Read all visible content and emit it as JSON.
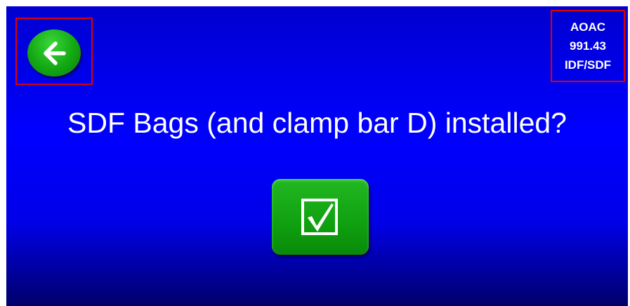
{
  "screen": {
    "question": "SDF Bags (and clamp bar D) installed?",
    "method": {
      "line1": "AOAC",
      "line2": "991.43",
      "line3": "IDF/SDF"
    },
    "back_icon": "arrow-left-icon",
    "confirm_icon": "checkbox-check-icon"
  },
  "colors": {
    "background": "#0000ff",
    "button_green": "#12a812",
    "highlight_frame": "#e00000",
    "text": "#ffffff"
  }
}
